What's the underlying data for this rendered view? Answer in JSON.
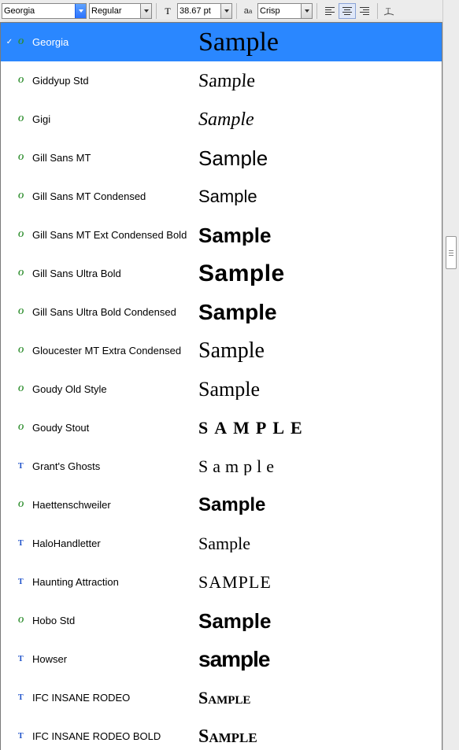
{
  "toolbar": {
    "font_family": "Georgia",
    "font_style": "Regular",
    "font_size": "38.67 pt",
    "antialias": "Crisp"
  },
  "selected_font": "Georgia",
  "sample_text": "Sample",
  "fonts": [
    {
      "name": "Georgia",
      "type": "ot",
      "selected": true,
      "sample_class": "s-georgia",
      "sample": "Sample"
    },
    {
      "name": "Giddyup Std",
      "type": "ot",
      "sample_class": "s-giddyup",
      "sample": "Sample"
    },
    {
      "name": "Gigi",
      "type": "ot",
      "sample_class": "s-gigi",
      "sample": "Sample"
    },
    {
      "name": "Gill Sans MT",
      "type": "ot",
      "sample_class": "s-gillsans",
      "sample": "Sample"
    },
    {
      "name": "Gill Sans MT Condensed",
      "type": "ot",
      "sample_class": "s-gillsanscond",
      "sample": "Sample"
    },
    {
      "name": "Gill Sans MT Ext Condensed Bold",
      "type": "ot",
      "sample_class": "s-gillsansextb",
      "sample": "Sample"
    },
    {
      "name": "Gill Sans Ultra Bold",
      "type": "ot",
      "sample_class": "s-gillsansub",
      "sample": "Sample"
    },
    {
      "name": "Gill Sans Ultra Bold Condensed",
      "type": "ot",
      "sample_class": "s-gillsansubc",
      "sample": "Sample"
    },
    {
      "name": "Gloucester MT Extra Condensed",
      "type": "ot",
      "sample_class": "s-gloucester",
      "sample": "Sample"
    },
    {
      "name": "Goudy Old Style",
      "type": "ot",
      "sample_class": "s-goudy",
      "sample": "Sample"
    },
    {
      "name": "Goudy Stout",
      "type": "ot",
      "sample_class": "s-goudystout",
      "sample": "Sample"
    },
    {
      "name": "Grant's Ghosts",
      "type": "tt",
      "sample_class": "s-grants",
      "sample": "Sample"
    },
    {
      "name": "Haettenschweiler",
      "type": "ot",
      "sample_class": "s-haet",
      "sample": "Sample"
    },
    {
      "name": "HaloHandletter",
      "type": "tt",
      "sample_class": "s-halo",
      "sample": "Sample"
    },
    {
      "name": "Haunting Attraction",
      "type": "tt",
      "sample_class": "s-haunting",
      "sample": "SAMPLE"
    },
    {
      "name": "Hobo Std",
      "type": "ot",
      "sample_class": "s-hobo",
      "sample": "Sample"
    },
    {
      "name": "Howser",
      "type": "tt",
      "sample_class": "s-howser",
      "sample": "sample"
    },
    {
      "name": "IFC INSANE RODEO",
      "type": "tt",
      "sample_class": "s-rodeo",
      "sample": "Sample"
    },
    {
      "name": "IFC INSANE RODEO BOLD",
      "type": "tt",
      "sample_class": "s-rodeob",
      "sample": "Sample"
    }
  ]
}
